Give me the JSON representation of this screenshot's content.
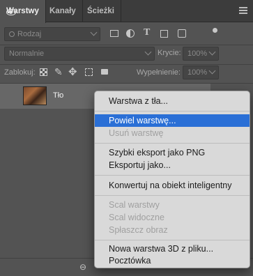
{
  "tabs": [
    {
      "label": "Warstwy"
    },
    {
      "label": "Kanały"
    },
    {
      "label": "Ścieżki"
    }
  ],
  "filter": {
    "kind_label": "Rodzaj",
    "icons": [
      "image-filter-icon",
      "adjustment-filter-icon",
      "type-filter-icon",
      "shape-filter-icon",
      "smart-object-filter-icon"
    ]
  },
  "blend": {
    "mode": "Normalnie",
    "opacity_label": "Krycie:",
    "opacity_value": "100%"
  },
  "lock": {
    "label": "Zablokuj:",
    "fill_label": "Wypełnienie:",
    "fill_value": "100%"
  },
  "layer": {
    "name": "Tło"
  },
  "menu": {
    "groups": [
      [
        {
          "label": "Warstwa z tła...",
          "enabled": true
        }
      ],
      [
        {
          "label": "Powiel warstwę...",
          "enabled": true,
          "highlighted": true
        },
        {
          "label": "Usuń warstwę",
          "enabled": false
        }
      ],
      [
        {
          "label": "Szybki eksport jako PNG",
          "enabled": true
        },
        {
          "label": "Eksportuj jako...",
          "enabled": true
        }
      ],
      [
        {
          "label": "Konwertuj na obiekt inteligentny",
          "enabled": true
        }
      ],
      [
        {
          "label": "Scal warstwy",
          "enabled": false
        },
        {
          "label": "Scal widoczne",
          "enabled": false
        },
        {
          "label": "Spłaszcz obraz",
          "enabled": false
        }
      ],
      [
        {
          "label": "Nowa warstwa 3D z pliku...",
          "enabled": true
        },
        {
          "label": "Pocztówka",
          "enabled": true
        }
      ]
    ]
  }
}
